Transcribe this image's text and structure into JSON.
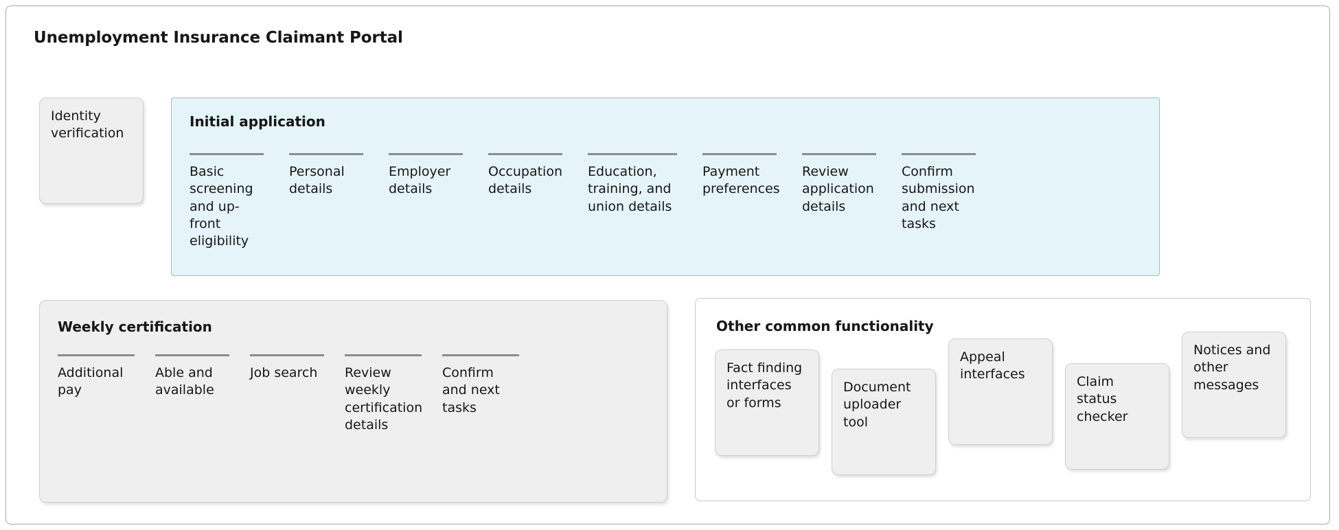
{
  "page": {
    "title": "Unemployment Insurance Claimant Portal"
  },
  "identity": {
    "label": "Identity verification"
  },
  "initial_application": {
    "heading": "Initial application",
    "steps": [
      {
        "label": "Basic screening and up-front eligibility"
      },
      {
        "label": "Personal details"
      },
      {
        "label": "Employer details"
      },
      {
        "label": "Occupation details"
      },
      {
        "label": "Education, training, and union details"
      },
      {
        "label": "Payment preferences"
      },
      {
        "label": "Review application details"
      },
      {
        "label": "Confirm submission and next tasks"
      }
    ]
  },
  "weekly_certification": {
    "heading": "Weekly certification",
    "steps": [
      {
        "label": "Additional pay"
      },
      {
        "label": "Able and available"
      },
      {
        "label": "Job search"
      },
      {
        "label": "Review weekly certification details"
      },
      {
        "label": "Confirm and next tasks"
      }
    ]
  },
  "other_common_functionality": {
    "heading": "Other common functionality",
    "tiles": [
      {
        "label": "Fact finding interfaces or forms"
      },
      {
        "label": "Document uploader tool"
      },
      {
        "label": "Appeal interfaces"
      },
      {
        "label": "Claim status checker"
      },
      {
        "label": "Notices and other messages"
      }
    ]
  },
  "colors": {
    "initial_panel_fill": "#e4f4f9",
    "initial_panel_border": "#a4bcc4",
    "card_fill": "#efefef",
    "card_border": "#cfcfcf",
    "rule": "#8c8c8c",
    "text": "#161616"
  }
}
